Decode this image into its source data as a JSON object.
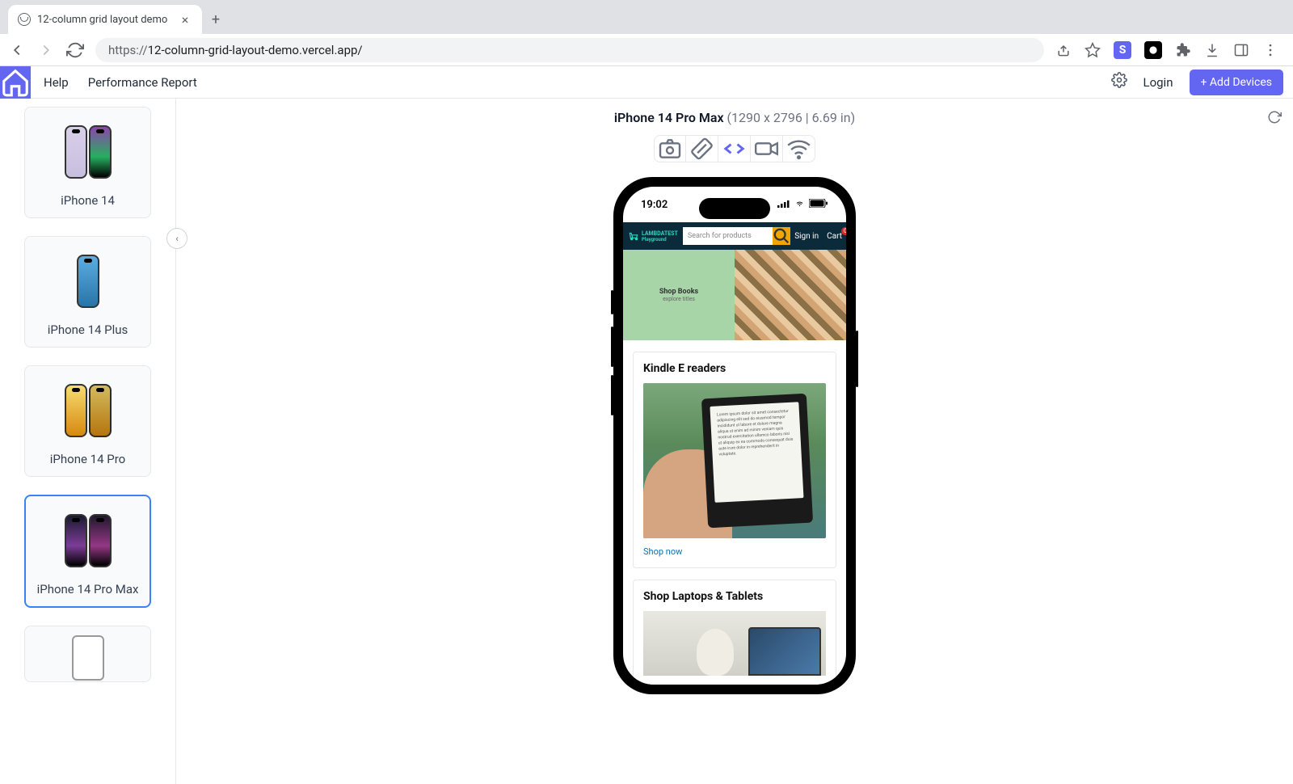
{
  "browser": {
    "tab_title": "12-column grid layout demo",
    "url_proto": "https://",
    "url_rest": "12-column-grid-layout-demo.vercel.app/"
  },
  "app_menu": {
    "help": "Help",
    "perf": "Performance Report",
    "login": "Login",
    "add_devices": "+ Add Devices"
  },
  "sidebar_devices": {
    "d0": "iPhone 14",
    "d1": "iPhone 14 Plus",
    "d2": "iPhone 14 Pro",
    "d3": "iPhone 14 Pro Max"
  },
  "preview": {
    "device_name": "iPhone 14 Pro Max",
    "device_meta": "(1290 x 2796 | 6.69 in)",
    "status_time": "19:02"
  },
  "mobile": {
    "logo_top": "LAMBDATEST",
    "logo_bottom": "Playground",
    "search_placeholder": "Search for products",
    "signin": "Sign in",
    "cart": "Cart",
    "cart_badge": "0",
    "hero_title": "Shop Books",
    "hero_sub": "explore titles",
    "card1_title": "Kindle E readers",
    "card1_link": "Shop now",
    "card2_title": "Shop Laptops & Tablets"
  }
}
